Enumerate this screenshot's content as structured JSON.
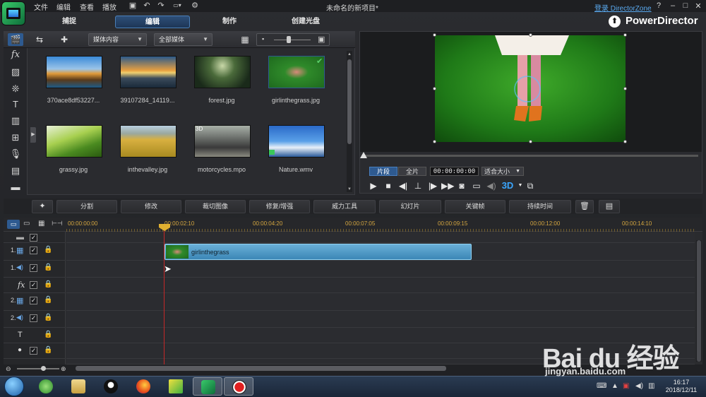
{
  "menu": {
    "file": "文件",
    "edit": "编辑",
    "view": "查看",
    "play": "播放"
  },
  "window": {
    "title": "未命名的新项目*",
    "login": "登录 DirectorZone",
    "help": "?",
    "minimize": "–",
    "maximize": "□",
    "close": "✕"
  },
  "modes": {
    "capture": "捕捉",
    "edit": "编辑",
    "produce": "制作",
    "disc": "创建光盘",
    "brand": "PowerDirector"
  },
  "library": {
    "filter1": "媒体内容",
    "filter2": "全部媒体",
    "items": [
      {
        "label": "370ace8df53227..."
      },
      {
        "label": "39107284_14119..."
      },
      {
        "label": "forest.jpg"
      },
      {
        "label": "girlinthegrass.jpg"
      },
      {
        "label": "grassy.jpg"
      },
      {
        "label": "inthevalley.jpg"
      },
      {
        "label": "motorcycles.mpo"
      },
      {
        "label": "Nature.wmv"
      }
    ],
    "badge_3d": "3D"
  },
  "preview": {
    "clip_mode": "片段",
    "full_mode": "全片",
    "timecode": "00:00:00:00",
    "fit": "适合大小",
    "three_d": "3D"
  },
  "functions": {
    "split": "分割",
    "modify": "修改",
    "crop": "裁切图像",
    "fix": "修复/增强",
    "power_tools": "威力工具",
    "slideshow": "幻灯片",
    "keyframe": "关键帧",
    "duration": "持续时间"
  },
  "timeline": {
    "ticks": [
      "00:00:00:00",
      "00:00:02:10",
      "00:00:04:20",
      "00:00:07:05",
      "00:00:09:15",
      "00:00:12:00",
      "00:00:14:10"
    ],
    "tracks": [
      {
        "num": "",
        "icon": "▦"
      },
      {
        "num": "1.",
        "icon": "▦"
      },
      {
        "num": "1.",
        "icon": "◀)"
      },
      {
        "num": "",
        "icon": "fx"
      },
      {
        "num": "2.",
        "icon": "▦"
      },
      {
        "num": "2.",
        "icon": "◀)"
      },
      {
        "num": "",
        "icon": "T"
      },
      {
        "num": "",
        "icon": "🎤"
      },
      {
        "num": "",
        "icon": "♫"
      }
    ],
    "clip_label": "girlinthegrass"
  },
  "taskbar": {
    "time": "16:17",
    "date": "2018/12/11"
  },
  "watermark": {
    "text": "Bai du 经验",
    "url": "jingyan.baidu.com"
  },
  "colors": {
    "accent_blue": "#2e5a90",
    "clip_blue": "#4a9ccb",
    "playhead": "#c62828",
    "ruler_text": "#d4a640"
  }
}
